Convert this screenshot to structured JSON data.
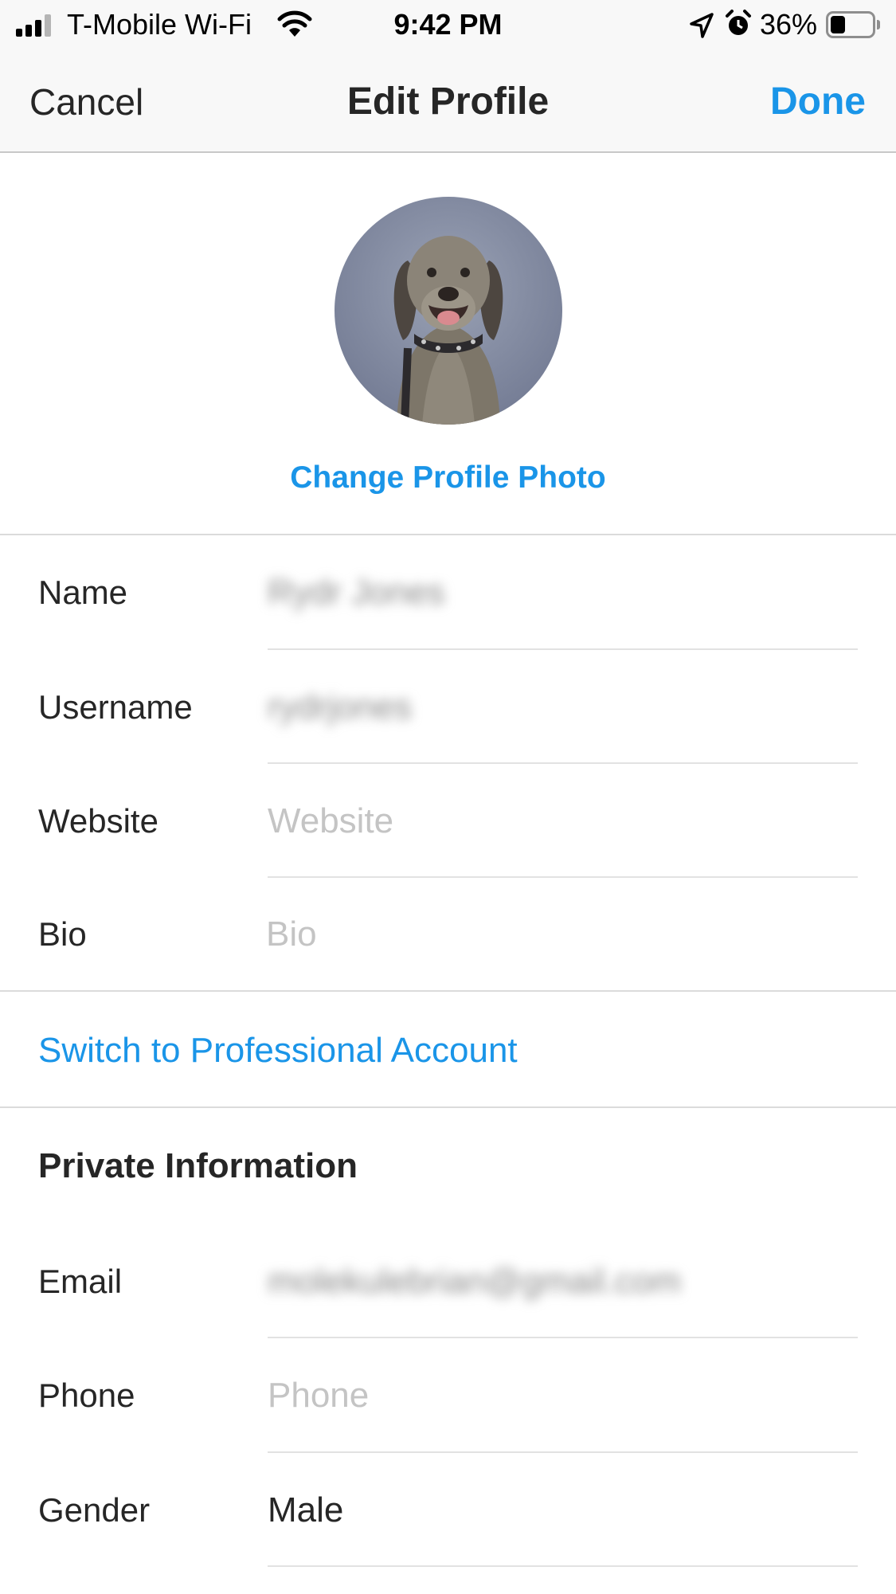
{
  "status_bar": {
    "carrier": "T-Mobile Wi-Fi",
    "time": "9:42 PM",
    "battery_percent": "36%",
    "battery_level": 0.36,
    "icons": [
      "signal-bars-icon",
      "wifi-icon",
      "location-arrow-icon",
      "alarm-clock-icon",
      "battery-icon"
    ]
  },
  "nav": {
    "cancel_label": "Cancel",
    "title": "Edit Profile",
    "done_label": "Done"
  },
  "profile": {
    "change_photo_label": "Change Profile Photo"
  },
  "fields": {
    "name": {
      "label": "Name",
      "value": "Rydr Jones"
    },
    "username": {
      "label": "Username",
      "value": "rydrjones"
    },
    "website": {
      "label": "Website",
      "placeholder": "Website"
    },
    "bio": {
      "label": "Bio",
      "placeholder": "Bio"
    }
  },
  "switch_label": "Switch to Professional Account",
  "private_info": {
    "title": "Private Information",
    "email": {
      "label": "Email",
      "value": "molekulebrian@gmail.com"
    },
    "phone": {
      "label": "Phone",
      "placeholder": "Phone"
    },
    "gender": {
      "label": "Gender",
      "value": "Male"
    }
  },
  "colors": {
    "accent": "#1a95e8",
    "text": "#262626",
    "placeholder": "#c4c4c4",
    "bar_background": "#f8f8f8"
  }
}
